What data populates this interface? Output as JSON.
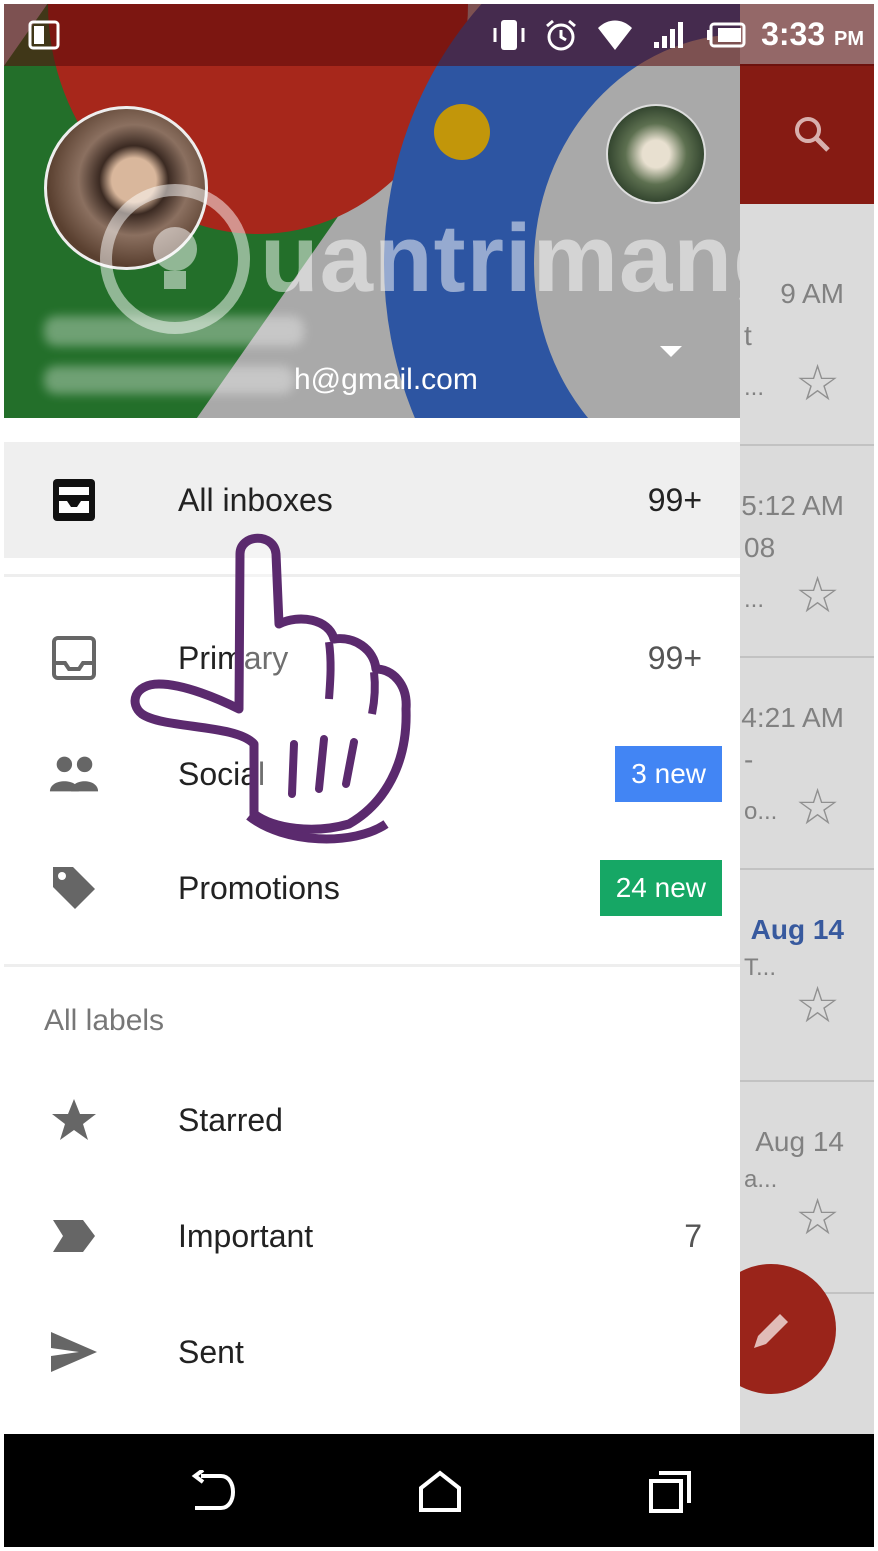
{
  "status_bar": {
    "time": "3:33",
    "ampm": "PM",
    "icons": [
      "notification-icon",
      "vibrate-icon",
      "alarm-icon",
      "wifi-icon",
      "signal-icon",
      "battery-icon"
    ]
  },
  "background_list": {
    "rows": [
      {
        "time": "9 AM",
        "snippet_a": "t",
        "snippet_b": "...",
        "time_blue": false
      },
      {
        "time": "5:12 AM",
        "snippet_a": "08",
        "snippet_b": "...",
        "time_blue": false
      },
      {
        "time": "4:21 AM",
        "snippet_a": "-",
        "snippet_b": "o...",
        "time_blue": false
      },
      {
        "time": "Aug 14",
        "snippet_a": "",
        "snippet_b": "T...",
        "time_blue": true
      },
      {
        "time": "Aug 14",
        "snippet_a": "",
        "snippet_b": "a...",
        "time_blue": false
      }
    ]
  },
  "account": {
    "email_visible": "h@gmail.com"
  },
  "watermark": {
    "text": "uantrimang"
  },
  "drawer": {
    "all_inboxes": {
      "label": "All inboxes",
      "count": "99+"
    },
    "primary": {
      "label": "Primary",
      "count": "99+"
    },
    "social": {
      "label": "Social",
      "badge": "3 new",
      "badge_color": "#4285f4"
    },
    "promotions": {
      "label": "Promotions",
      "badge": "24 new",
      "badge_color": "#16a765"
    },
    "all_labels_title": "All labels",
    "starred": {
      "label": "Starred"
    },
    "important": {
      "label": "Important",
      "count": "7"
    },
    "sent": {
      "label": "Sent"
    }
  },
  "colors": {
    "toolbar_red": "#8f1d15",
    "selected_row": "#efefef",
    "hand_outline": "#5b2a6e"
  }
}
